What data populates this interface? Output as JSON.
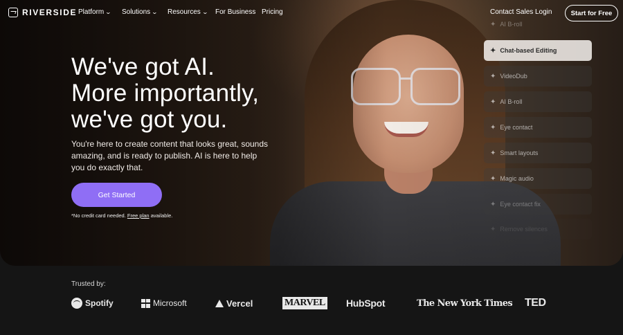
{
  "brand": {
    "name": "RIVERSIDE",
    "logo_icon": "riverside-logo-icon"
  },
  "nav": {
    "items": [
      {
        "label": "Platform",
        "dropdown": true
      },
      {
        "label": "Solutions",
        "dropdown": true
      },
      {
        "label": "Resources",
        "dropdown": true
      },
      {
        "label": "For Business",
        "dropdown": false
      },
      {
        "label": "Pricing",
        "dropdown": false
      }
    ],
    "contact_sales": "Contact Sales",
    "login": "Login",
    "start_free": "Start for Free"
  },
  "hero": {
    "headline": [
      "We've got AI.",
      "More importantly,",
      "we've got you."
    ],
    "subtext": "You're here to create content that looks great, sounds amazing, and is ready to publish. AI is here to help you do exactly that.",
    "cta_label": "Get Started",
    "note_prefix": "*No credit card needed.",
    "note_link": "Free plan",
    "note_suffix": "available."
  },
  "features": {
    "items": [
      {
        "label": "AI B-roll",
        "state": "faded"
      },
      {
        "label": "Chat-based Editing",
        "state": "active"
      },
      {
        "label": "VideoDub",
        "state": "dim"
      },
      {
        "label": "AI B-roll",
        "state": "dim"
      },
      {
        "label": "Eye contact",
        "state": "dim"
      },
      {
        "label": "Smart layouts",
        "state": "dim"
      },
      {
        "label": "Magic audio",
        "state": "dim"
      },
      {
        "label": "Eye contact fix",
        "state": "faded"
      },
      {
        "label": "Remove silences",
        "state": "faded"
      }
    ]
  },
  "trusted": {
    "label": "Trusted by:",
    "logos": [
      "Spotify",
      "Microsoft",
      "Vercel",
      "MARVEL",
      "HubSpot",
      "The New York Times",
      "TED"
    ]
  },
  "colors": {
    "cta": "#8f6ef5",
    "background": "#151515"
  }
}
